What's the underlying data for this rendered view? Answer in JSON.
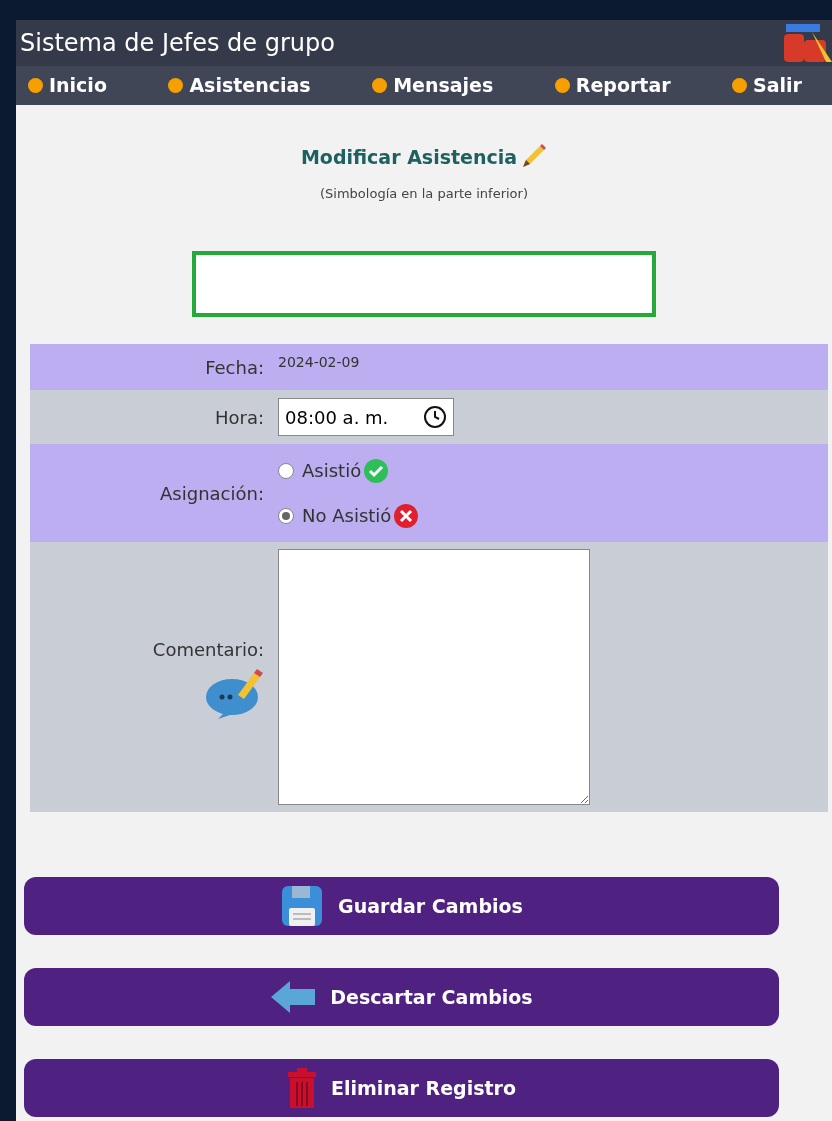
{
  "header": {
    "title": "Sistema de Jefes de grupo"
  },
  "nav": [
    "Inicio",
    "Asistencias",
    "Mensajes",
    "Reportar",
    "Salir"
  ],
  "heading": "Modificar Asistencia",
  "subheading": "(Simbología en la parte inferior)",
  "form": {
    "fecha": {
      "label": "Fecha:",
      "value": "2024-02-09"
    },
    "hora": {
      "label": "Hora:",
      "value": "08:00 a. m."
    },
    "asignacion": {
      "label": "Asignación:",
      "options": [
        {
          "label": "Asistió",
          "kind": "present",
          "selected": false
        },
        {
          "label": "No Asistió",
          "kind": "absent",
          "selected": true
        }
      ]
    },
    "comentario": {
      "label": "Comentario:"
    }
  },
  "buttons": [
    {
      "label": "Guardar Cambios",
      "kind": "save"
    },
    {
      "label": "Descartar Cambios",
      "kind": "back"
    },
    {
      "label": "Eliminar Registro",
      "kind": "delete"
    }
  ]
}
